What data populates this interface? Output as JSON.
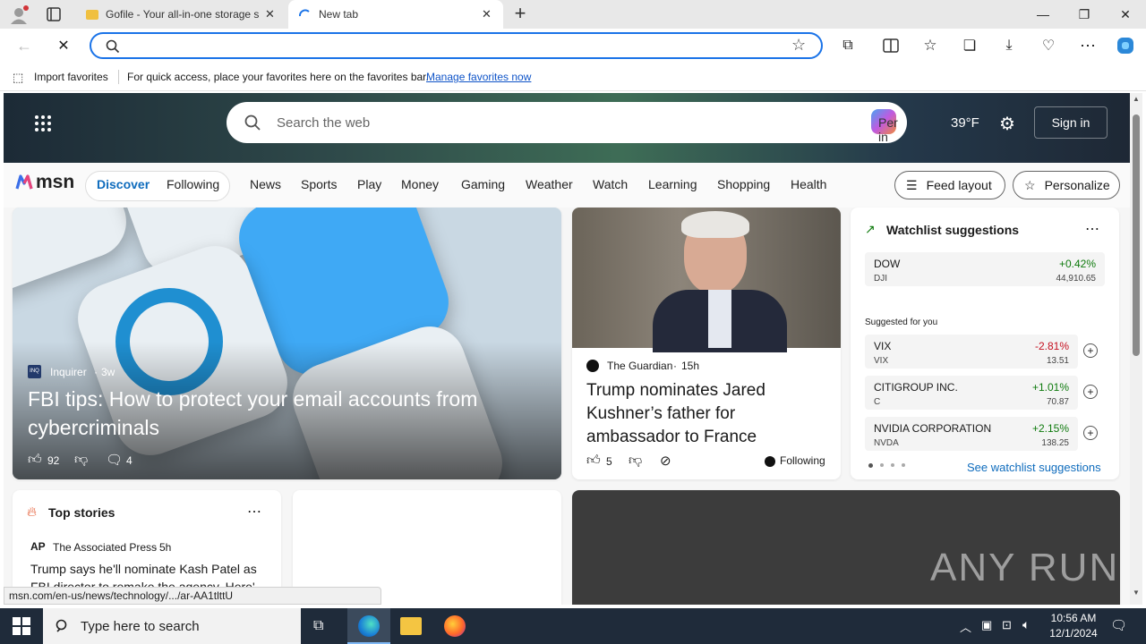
{
  "browser": {
    "tabs": [
      {
        "title": "Gofile - Your all-in-one storage s",
        "active": false
      },
      {
        "title": "New tab",
        "active": true
      }
    ],
    "address_value": "",
    "favorites_bar": {
      "import_label": "Import favorites",
      "message": "For quick access, place your favorites here on the favorites bar.",
      "manage_link": "Manage favorites now"
    },
    "status_url": "msn.com/en-us/news/technology/.../ar-AA1tlttU"
  },
  "msn": {
    "search_placeholder": "Search the web",
    "search_overlay_text": "Per  in",
    "temperature": "39°F",
    "sign_in": "Sign in",
    "logo_text": "msn",
    "tabs": {
      "discover": "Discover",
      "following": "Following"
    },
    "categories": [
      "News",
      "Sports",
      "Play",
      "Money",
      "Gaming",
      "Weather",
      "Watch",
      "Learning",
      "Shopping",
      "Health"
    ],
    "feed_layout": "Feed layout",
    "personalize": "Personalize",
    "hero_article": {
      "source": "Inquirer",
      "age": "3w",
      "headline": "FBI tips: How to protect your email accounts from cybercriminals",
      "likes": "92",
      "comments": "4"
    },
    "side_article": {
      "source": "The Guardian",
      "age": "15h",
      "headline": "Trump nominates Jared Kushner’s father for ambassador to France",
      "likes": "5",
      "following": "Following"
    },
    "watchlist": {
      "title": "Watchlist suggestions",
      "main": {
        "name": "DOW",
        "symbol": "DJI",
        "change": "+0.42%",
        "price": "44,910.65"
      },
      "suggested_label": "Suggested for you",
      "suggestions": [
        {
          "name": "VIX",
          "symbol": "VIX",
          "change": "-2.81%",
          "price": "13.51",
          "direction": "down"
        },
        {
          "name": "CITIGROUP INC.",
          "symbol": "C",
          "change": "+1.01%",
          "price": "70.87",
          "direction": "up"
        },
        {
          "name": "NVIDIA CORPORATION",
          "symbol": "NVDA",
          "change": "+2.15%",
          "price": "138.25",
          "direction": "up"
        }
      ],
      "see_link": "See watchlist suggestions"
    },
    "top_stories": {
      "title": "Top stories",
      "source": "The Associated Press",
      "age": "5h",
      "headline": "Trump says he'll nominate Kash Patel as FBI director to remake the agency. Here'..."
    },
    "watermark": "ANY RUN"
  },
  "taskbar": {
    "search_placeholder": "Type here to search",
    "time": "10:56 AM",
    "date": "12/1/2024"
  }
}
